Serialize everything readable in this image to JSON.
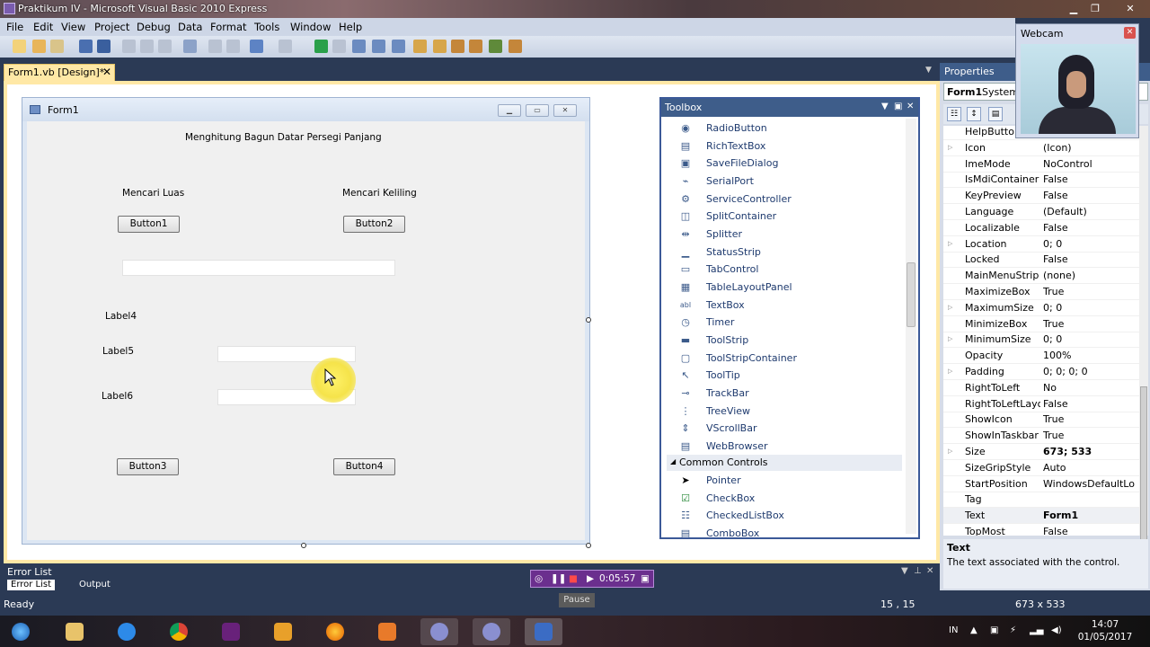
{
  "window": {
    "title": "Praktikum IV - Microsoft Visual Basic 2010 Express"
  },
  "menu": [
    "File",
    "Edit",
    "View",
    "Project",
    "Debug",
    "Data",
    "Format",
    "Tools",
    "Window",
    "Help"
  ],
  "doc_tab": {
    "label": "Form1.vb [Design]*",
    "close": "✕"
  },
  "form": {
    "title": "Form1",
    "heading": "Menghitung Bagun Datar Persegi Panjang",
    "label_luas": "Mencari Luas",
    "label_keliling": "Mencari Keliling",
    "button1": "Button1",
    "button2": "Button2",
    "label4": "Label4",
    "label5": "Label5",
    "label6": "Label6",
    "button3": "Button3",
    "button4": "Button4"
  },
  "toolbox": {
    "title": "Toolbox",
    "items_top": [
      {
        "label": "RadioButton",
        "icon": "radio-icon"
      },
      {
        "label": "RichTextBox",
        "icon": "richtext-icon"
      },
      {
        "label": "SaveFileDialog",
        "icon": "save-dialog-icon"
      },
      {
        "label": "SerialPort",
        "icon": "serialport-icon"
      },
      {
        "label": "ServiceController",
        "icon": "service-icon"
      },
      {
        "label": "SplitContainer",
        "icon": "splitcontainer-icon"
      },
      {
        "label": "Splitter",
        "icon": "splitter-icon"
      },
      {
        "label": "StatusStrip",
        "icon": "statusstrip-icon"
      },
      {
        "label": "TabControl",
        "icon": "tabcontrol-icon"
      },
      {
        "label": "TableLayoutPanel",
        "icon": "tablelayout-icon"
      },
      {
        "label": "TextBox",
        "icon": "textbox-icon"
      },
      {
        "label": "Timer",
        "icon": "timer-icon"
      },
      {
        "label": "ToolStrip",
        "icon": "toolstrip-icon"
      },
      {
        "label": "ToolStripContainer",
        "icon": "toolstripcontainer-icon"
      },
      {
        "label": "ToolTip",
        "icon": "tooltip-icon"
      },
      {
        "label": "TrackBar",
        "icon": "trackbar-icon"
      },
      {
        "label": "TreeView",
        "icon": "treeview-icon"
      },
      {
        "label": "VScrollBar",
        "icon": "vscrollbar-icon"
      },
      {
        "label": "WebBrowser",
        "icon": "webbrowser-icon"
      }
    ],
    "group": "Common Controls",
    "items_bottom": [
      {
        "label": "Pointer",
        "icon": "pointer-icon"
      },
      {
        "label": "CheckBox",
        "icon": "checkbox-icon"
      },
      {
        "label": "CheckedListBox",
        "icon": "checkedlistbox-icon"
      },
      {
        "label": "ComboBox",
        "icon": "combobox-icon"
      }
    ]
  },
  "properties": {
    "title": "Properties",
    "object_name": "Form1",
    "object_type": "System",
    "rows": [
      {
        "name": "HelpButton",
        "value": "",
        "expand": false
      },
      {
        "name": "Icon",
        "value": "(Icon)",
        "expand": true
      },
      {
        "name": "ImeMode",
        "value": "NoControl",
        "expand": false
      },
      {
        "name": "IsMdiContainer",
        "value": "False",
        "expand": false
      },
      {
        "name": "KeyPreview",
        "value": "False",
        "expand": false
      },
      {
        "name": "Language",
        "value": "(Default)",
        "expand": false
      },
      {
        "name": "Localizable",
        "value": "False",
        "expand": false
      },
      {
        "name": "Location",
        "value": "0; 0",
        "expand": true
      },
      {
        "name": "Locked",
        "value": "False",
        "expand": false
      },
      {
        "name": "MainMenuStrip",
        "value": "(none)",
        "expand": false
      },
      {
        "name": "MaximizeBox",
        "value": "True",
        "expand": false
      },
      {
        "name": "MaximumSize",
        "value": "0; 0",
        "expand": true
      },
      {
        "name": "MinimizeBox",
        "value": "True",
        "expand": false
      },
      {
        "name": "MinimumSize",
        "value": "0; 0",
        "expand": true
      },
      {
        "name": "Opacity",
        "value": "100%",
        "expand": false
      },
      {
        "name": "Padding",
        "value": "0; 0; 0; 0",
        "expand": true
      },
      {
        "name": "RightToLeft",
        "value": "No",
        "expand": false
      },
      {
        "name": "RightToLeftLayout",
        "value": "False",
        "expand": false
      },
      {
        "name": "ShowIcon",
        "value": "True",
        "expand": false
      },
      {
        "name": "ShowInTaskbar",
        "value": "True",
        "expand": false
      },
      {
        "name": "Size",
        "value": "673; 533",
        "expand": true
      },
      {
        "name": "SizeGripStyle",
        "value": "Auto",
        "expand": false
      },
      {
        "name": "StartPosition",
        "value": "WindowsDefaultLo",
        "expand": false
      },
      {
        "name": "Tag",
        "value": "",
        "expand": false
      },
      {
        "name": "Text",
        "value": "Form1",
        "expand": false
      },
      {
        "name": "TopMost",
        "value": "False",
        "expand": false
      }
    ],
    "desc_title": "Text",
    "desc_text": "The text associated with the control."
  },
  "webcam": {
    "title": "Webcam"
  },
  "error_list": {
    "title": "Error List",
    "tab1": "Error List",
    "tab2": "Output"
  },
  "recorder": {
    "time": "0:05:57",
    "tooltip": "Pause"
  },
  "status": {
    "left": "Ready",
    "position": "15 , 15",
    "size": "673 x 533"
  },
  "taskbar": {
    "lang": "IN",
    "time": "14:07",
    "date": "01/05/2017"
  },
  "colors": {
    "accent": "#3e5d8a",
    "designer_border": "#ffe8a6",
    "recorder": "#6b2f8e"
  }
}
